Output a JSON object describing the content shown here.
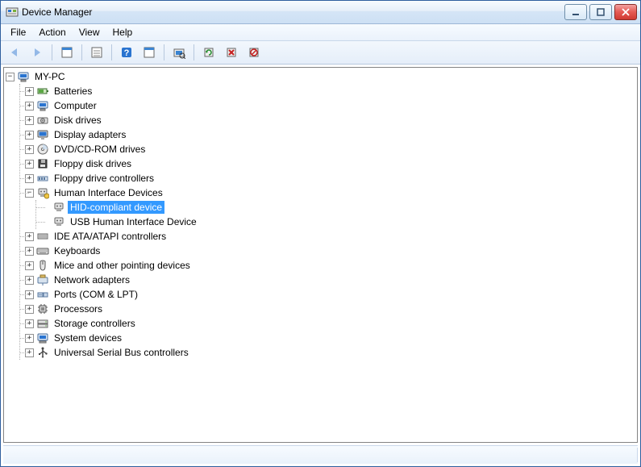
{
  "window": {
    "title": "Device Manager"
  },
  "menu": {
    "file": "File",
    "action": "Action",
    "view": "View",
    "help": "Help"
  },
  "expander": {
    "plus": "+",
    "minus": "−"
  },
  "tree": {
    "root": "MY-PC",
    "items": [
      {
        "label": "Batteries"
      },
      {
        "label": "Computer"
      },
      {
        "label": "Disk drives"
      },
      {
        "label": "Display adapters"
      },
      {
        "label": "DVD/CD-ROM drives"
      },
      {
        "label": "Floppy disk drives"
      },
      {
        "label": "Floppy drive controllers"
      },
      {
        "label": "Human Interface Devices",
        "expanded": true,
        "children": [
          {
            "label": "HID-compliant device",
            "selected": true
          },
          {
            "label": "USB Human Interface Device"
          }
        ]
      },
      {
        "label": "IDE ATA/ATAPI controllers"
      },
      {
        "label": "Keyboards"
      },
      {
        "label": "Mice and other pointing devices"
      },
      {
        "label": "Network adapters"
      },
      {
        "label": "Ports (COM & LPT)"
      },
      {
        "label": "Processors"
      },
      {
        "label": "Storage controllers"
      },
      {
        "label": "System devices"
      },
      {
        "label": "Universal Serial Bus controllers"
      }
    ]
  }
}
